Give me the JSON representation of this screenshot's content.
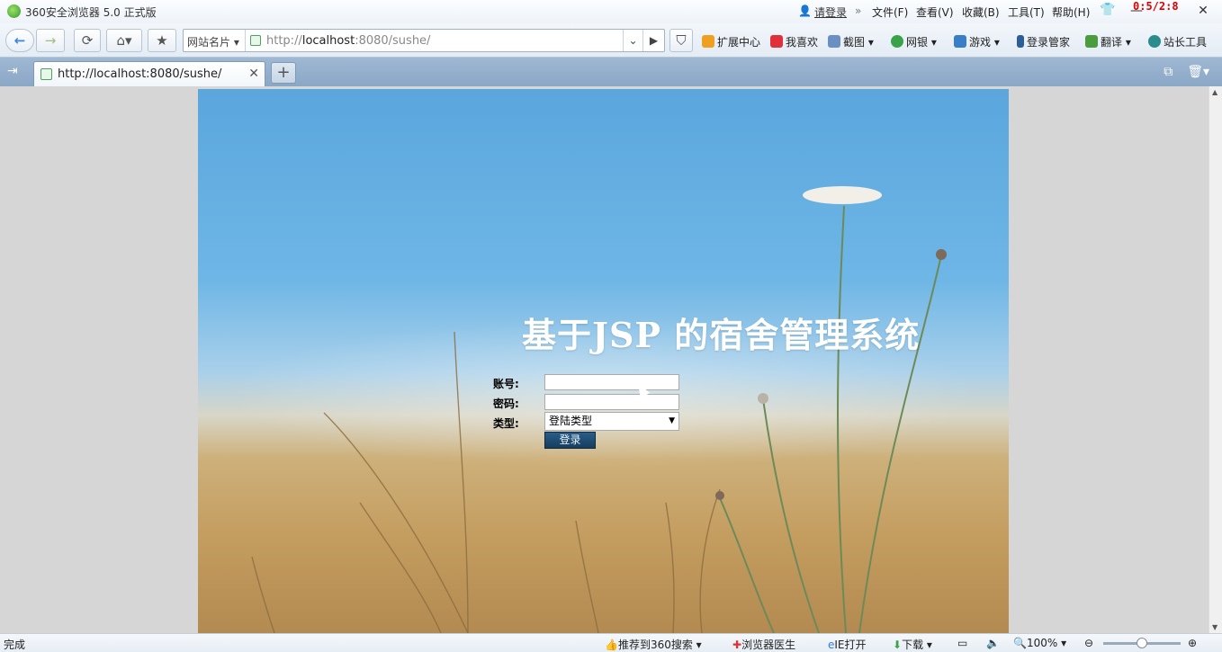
{
  "window": {
    "title": "360安全浏览器 5.0 正式版",
    "login_link": "请登录",
    "menu": [
      "文件(F)",
      "查看(V)",
      "收藏(B)",
      "工具(T)",
      "帮助(H)"
    ],
    "clock": "0:5/2:8"
  },
  "navbar": {
    "card_label": "网站名片",
    "url_prefix": "http://",
    "url_host": "localhost",
    "url_rest": ":8080/sushe/",
    "toolbar_items": [
      "扩展中心",
      "我喜欢",
      "截图",
      "网银",
      "游戏",
      "登录管家",
      "翻译",
      "站长工具"
    ]
  },
  "tabs": [
    {
      "title": "http://localhost:8080/sushe/"
    }
  ],
  "page": {
    "title": "基于JSP 的宿舍管理系统",
    "account_label": "账号:",
    "password_label": "密码:",
    "type_label": "类型:",
    "account_value": "",
    "password_value": "",
    "type_selected": "登陆类型",
    "login_button": "登录"
  },
  "statusbar": {
    "status": "完成",
    "recommend": "推荐到360搜索",
    "doctor": "浏览器医生",
    "ie_open": "IE打开",
    "download": "下载",
    "zoom": "100%"
  },
  "colors": {
    "accent": "#2f7fd6",
    "login_button_bg": "#1f4c73",
    "clock": "#dd0000"
  }
}
